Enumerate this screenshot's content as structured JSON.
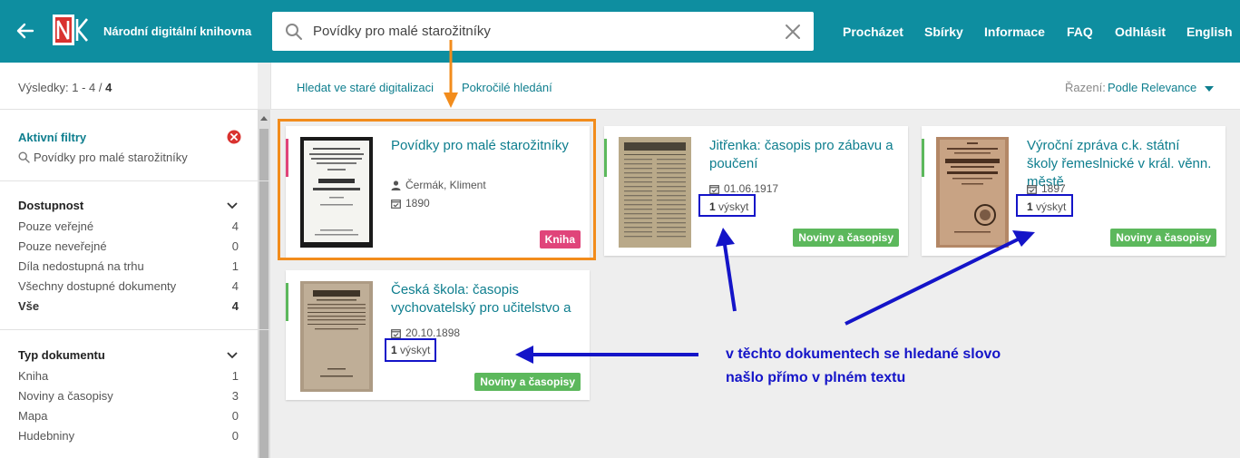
{
  "header": {
    "app_title": "Národní digitální knihovna",
    "search_query": "Povídky pro malé starožitníky",
    "nav": [
      "Procházet",
      "Sbírky",
      "Informace",
      "FAQ",
      "Odhlásit",
      "English"
    ],
    "bg_color": "#0e8ea0"
  },
  "sidebar": {
    "results_label": "Výsledky: 1 - 4 / ",
    "results_total": "4",
    "active_filters_title": "Aktivní filtry",
    "active_filter_value": "Povídky pro malé starožitníky",
    "availability": {
      "title": "Dostupnost",
      "items": [
        {
          "label": "Pouze veřejné",
          "count": "4"
        },
        {
          "label": "Pouze neveřejné",
          "count": "0"
        },
        {
          "label": "Díla nedostupná na trhu",
          "count": "1"
        },
        {
          "label": "Všechny dostupné dokumenty",
          "count": "4"
        },
        {
          "label": "Vše",
          "count": "4"
        }
      ]
    },
    "doc_type": {
      "title": "Typ dokumentu",
      "items": [
        {
          "label": "Kniha",
          "count": "1"
        },
        {
          "label": "Noviny a časopisy",
          "count": "3"
        },
        {
          "label": "Mapa",
          "count": "0"
        },
        {
          "label": "Hudebniny",
          "count": "0"
        }
      ]
    }
  },
  "toolbar": {
    "old_search_link": "Hledat ve staré digitalizaci",
    "advanced_link": "Pokročilé hledání",
    "sort_label": "Řazení:",
    "sort_value": "Podle Relevance"
  },
  "results": [
    {
      "title": "Povídky pro malé starožitníky",
      "author": "Čermák, Kliment",
      "date": "1890",
      "hits_count": "",
      "hits_label": "",
      "badge": "Kniha",
      "badge_color": "#e0447a"
    },
    {
      "title": "Jitřenka: časopis pro zábavu a poučení",
      "author": "",
      "date": "01.06.1917",
      "hits_count": "1",
      "hits_label": " výskyt",
      "badge": "Noviny a časopisy",
      "badge_color": "#5cb85c"
    },
    {
      "title": "Výroční zpráva c.k. státní školy řemeslnické v král. věnn. městě",
      "author": "",
      "date": "1897",
      "hits_count": "1",
      "hits_label": " výskyt",
      "badge": "Noviny a časopisy",
      "badge_color": "#5cb85c"
    },
    {
      "title": "Česká škola: časopis vychovatelský pro učitelstvo a",
      "author": "",
      "date": "20.10.1898",
      "hits_count": "1",
      "hits_label": " výskyt",
      "badge": "Noviny a časopisy",
      "badge_color": "#5cb85c"
    }
  ],
  "annotation": {
    "line1": "v těchto dokumentech se hledané slovo",
    "line2": "našlo přímo v plném textu",
    "color": "#1414c8",
    "highlight_color": "#f28c1c"
  }
}
